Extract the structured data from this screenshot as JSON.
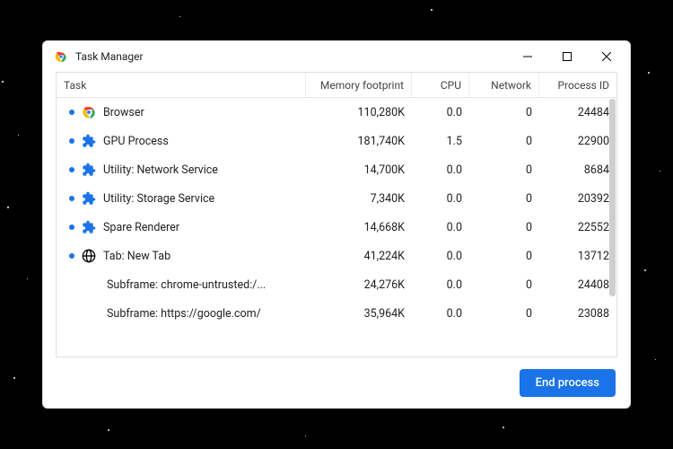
{
  "window": {
    "title": "Task Manager"
  },
  "columns": {
    "task": "Task",
    "memory": "Memory footprint",
    "cpu": "CPU",
    "network": "Network",
    "pid": "Process ID"
  },
  "rows": [
    {
      "icon": "chrome",
      "dot": true,
      "indent": 0,
      "task": "Browser",
      "memory": "110,280K",
      "cpu": "0.0",
      "network": "0",
      "pid": "24484"
    },
    {
      "icon": "puzzle",
      "dot": true,
      "indent": 0,
      "task": "GPU Process",
      "memory": "181,740K",
      "cpu": "1.5",
      "network": "0",
      "pid": "22900"
    },
    {
      "icon": "puzzle",
      "dot": true,
      "indent": 0,
      "task": "Utility: Network Service",
      "memory": "14,700K",
      "cpu": "0.0",
      "network": "0",
      "pid": "8684"
    },
    {
      "icon": "puzzle",
      "dot": true,
      "indent": 0,
      "task": "Utility: Storage Service",
      "memory": "7,340K",
      "cpu": "0.0",
      "network": "0",
      "pid": "20392"
    },
    {
      "icon": "puzzle",
      "dot": true,
      "indent": 0,
      "task": "Spare Renderer",
      "memory": "14,668K",
      "cpu": "0.0",
      "network": "0",
      "pid": "22552"
    },
    {
      "icon": "globe",
      "dot": true,
      "indent": 0,
      "task": "Tab: New Tab",
      "memory": "41,224K",
      "cpu": "0.0",
      "network": "0",
      "pid": "13712"
    },
    {
      "icon": "none",
      "dot": false,
      "indent": 1,
      "task": "Subframe: chrome-untrusted:/...",
      "memory": "24,276K",
      "cpu": "0.0",
      "network": "0",
      "pid": "24408"
    },
    {
      "icon": "none",
      "dot": false,
      "indent": 1,
      "task": "Subframe: https://google.com/",
      "memory": "35,964K",
      "cpu": "0.0",
      "network": "0",
      "pid": "23088"
    }
  ],
  "footer": {
    "end_process": "End process"
  }
}
